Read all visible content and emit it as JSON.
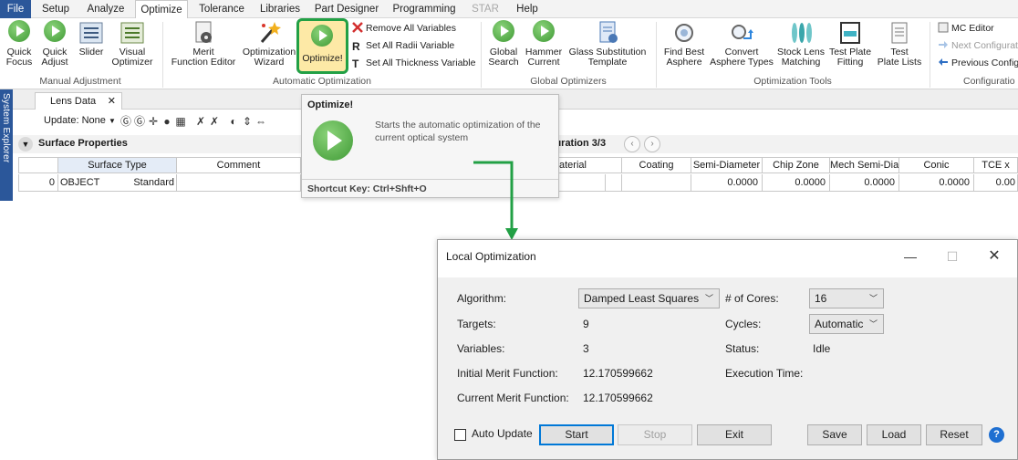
{
  "menu": {
    "items": [
      "File",
      "Setup",
      "Analyze",
      "Optimize",
      "Tolerance",
      "Libraries",
      "Part Designer",
      "Programming",
      "STAR",
      "Help"
    ],
    "active": "Optimize"
  },
  "ribbon": {
    "manual": {
      "buttons": [
        {
          "line1": "Quick",
          "line2": "Focus",
          "icon": "quick-focus-icon"
        },
        {
          "line1": "Quick",
          "line2": "Adjust",
          "icon": "quick-adjust-icon"
        },
        {
          "line1": "Slider",
          "line2": "",
          "icon": "slider-icon"
        },
        {
          "line1": "Visual",
          "line2": "Optimizer",
          "icon": "visual-optimizer-icon"
        }
      ],
      "group_label": "Manual Adjustment"
    },
    "automatic": {
      "buttons": [
        {
          "line1": "Merit",
          "line2": "Function Editor",
          "icon": "merit-function-icon"
        },
        {
          "line1": "Optimization",
          "line2": "Wizard",
          "icon": "wand-icon"
        },
        {
          "line1": "",
          "line2": "Optimize!",
          "icon": "play-icon"
        }
      ],
      "small": [
        "Remove All Variables",
        "Set All Radii Variable",
        "Set All Thickness Variable"
      ],
      "group_label": "Automatic Optimization"
    },
    "global": {
      "buttons": [
        {
          "line1": "Global",
          "line2": "Search",
          "icon": "global-search-icon"
        },
        {
          "line1": "Hammer",
          "line2": "Current",
          "icon": "hammer-icon"
        },
        {
          "line1": "Glass Substitution",
          "line2": "Template",
          "icon": "glass-template-icon"
        }
      ],
      "group_label": "Global Optimizers"
    },
    "tools": {
      "buttons": [
        {
          "line1": "Find Best",
          "line2": "Asphere",
          "icon": "find-asphere-icon"
        },
        {
          "line1": "Convert",
          "line2": "Asphere Types",
          "icon": "convert-asphere-icon"
        },
        {
          "line1": "Stock Lens",
          "line2": "Matching",
          "icon": "stock-lens-icon"
        },
        {
          "line1": "Test Plate",
          "line2": "Fitting",
          "icon": "test-plate-fitting-icon"
        },
        {
          "line1": "Test",
          "line2": "Plate Lists",
          "icon": "test-plate-list-icon"
        }
      ],
      "group_label": "Optimization Tools"
    },
    "config": {
      "small": [
        "MC Editor",
        "Next Configurat",
        "Previous Config"
      ],
      "group_label": "Configuratio"
    }
  },
  "sidebar": {
    "label": "System Explorer"
  },
  "lens_data": {
    "tab_label": "Lens Data",
    "update_label": "Update: None",
    "section_title": "Surface Properties",
    "config_label": "figuration 3/3",
    "columns": [
      "Surface Type",
      "Comment",
      "aterial",
      "Coating",
      "Semi-Diameter",
      "Chip Zone",
      "Mech Semi-Dia",
      "Conic",
      "TCE x"
    ],
    "row": {
      "index": "0",
      "name": "OBJECT",
      "type": "Standard",
      "semi_diameter": "0.0000",
      "chip_zone": "0.0000",
      "mech_semi_dia": "0.0000",
      "conic": "0.0000",
      "tce": "0.00"
    }
  },
  "tooltip": {
    "title": "Optimize!",
    "description": "Starts the automatic optimization of the current optical system",
    "shortcut": "Shortcut Key: Ctrl+Shft+O"
  },
  "dialog": {
    "title": "Local Optimization",
    "algorithm_label": "Algorithm:",
    "algorithm_value": "Damped Least Squares",
    "cores_label": "# of Cores:",
    "cores_value": "16",
    "targets_label": "Targets:",
    "targets_value": "9",
    "cycles_label": "Cycles:",
    "cycles_value": "Automatic",
    "variables_label": "Variables:",
    "variables_value": "3",
    "status_label": "Status:",
    "status_value": "Idle",
    "initial_mf_label": "Initial Merit Function:",
    "initial_mf_value": "12.170599662",
    "execution_time_label": "Execution Time:",
    "current_mf_label": "Current Merit Function:",
    "current_mf_value": "12.170599662",
    "auto_update_label": "Auto Update",
    "buttons": {
      "start": "Start",
      "stop": "Stop",
      "exit": "Exit",
      "save": "Save",
      "load": "Load",
      "reset": "Reset"
    },
    "help_glyph": "?"
  },
  "colors": {
    "file_tab": "#2b579a",
    "highlight_border": "#22a045",
    "highlight_fill": "#fde9a6",
    "arrow": "#22a045",
    "play_green": "#3f9a35"
  }
}
